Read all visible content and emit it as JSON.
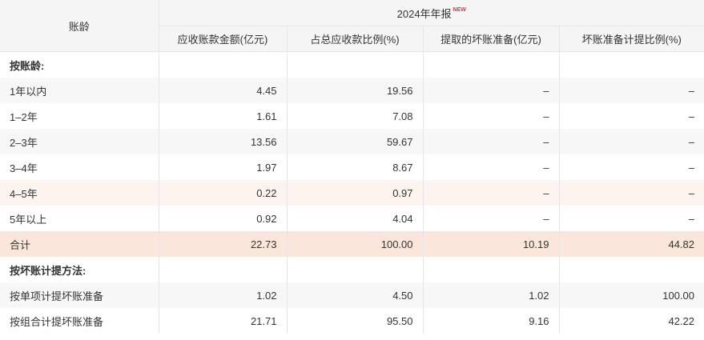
{
  "header": {
    "age_label": "账龄",
    "period_label": "2024年年报",
    "new_badge": "NEW",
    "columns": [
      "应收账款金额(亿元)",
      "占总应收款比例(%)",
      "提取的坏账准备(亿元)",
      "坏账准备计提比例(%)"
    ]
  },
  "rows": [
    {
      "label": "按账龄:",
      "values": [
        "",
        "",
        "",
        ""
      ]
    },
    {
      "label": "1年以内",
      "values": [
        "4.45",
        "19.56",
        "–",
        "–"
      ]
    },
    {
      "label": "1–2年",
      "values": [
        "1.61",
        "7.08",
        "–",
        "–"
      ]
    },
    {
      "label": "2–3年",
      "values": [
        "13.56",
        "59.67",
        "–",
        "–"
      ]
    },
    {
      "label": "3–4年",
      "values": [
        "1.97",
        "8.67",
        "–",
        "–"
      ]
    },
    {
      "label": "4–5年",
      "values": [
        "0.22",
        "0.97",
        "–",
        "–"
      ]
    },
    {
      "label": "5年以上",
      "values": [
        "0.92",
        "4.04",
        "–",
        "–"
      ]
    },
    {
      "label": "合计",
      "values": [
        "22.73",
        "100.00",
        "10.19",
        "44.82"
      ]
    },
    {
      "label": "按坏账计提方法:",
      "values": [
        "",
        "",
        "",
        ""
      ]
    },
    {
      "label": "按单项计提坏账准备",
      "values": [
        "1.02",
        "4.50",
        "1.02",
        "100.00"
      ]
    },
    {
      "label": "按组合计提坏账准备",
      "values": [
        "21.71",
        "95.50",
        "9.16",
        "42.22"
      ]
    }
  ],
  "colors": {
    "header_bg": "#f5f5f5",
    "stripe_bg": "#f7f7f7",
    "highlight_bg": "#fdf4ef",
    "total_bg": "#fbe6db",
    "new_badge": "#e4393c"
  }
}
